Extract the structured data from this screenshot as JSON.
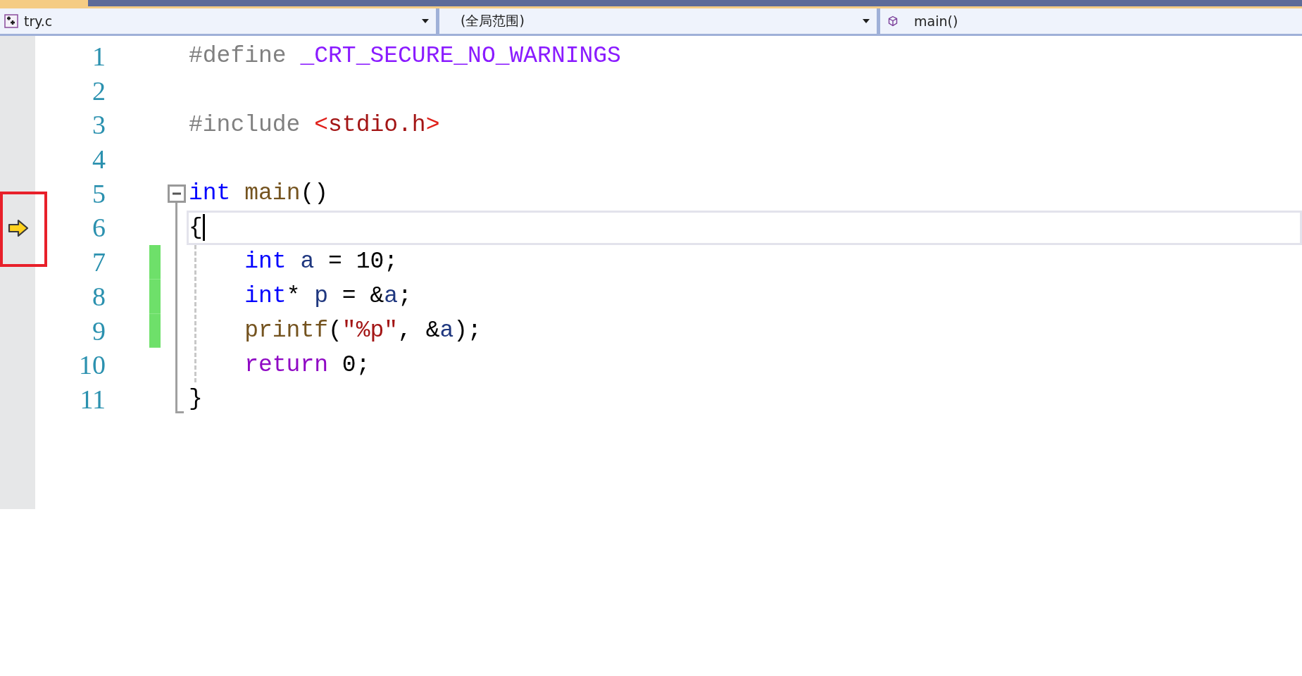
{
  "document_tab": {
    "selected": true
  },
  "navigation_bar": {
    "file": {
      "label": "try.c"
    },
    "scope": {
      "label": "(全局范围)"
    },
    "member": {
      "label": "main()"
    }
  },
  "editor": {
    "lines": [
      {
        "number": "1",
        "tokens": [
          {
            "kind": "preproc",
            "text": "#define "
          },
          {
            "kind": "macro",
            "text": "_CRT_SECURE_NO_WARNINGS"
          }
        ]
      },
      {
        "number": "2"
      },
      {
        "number": "3",
        "tokens": [
          {
            "kind": "preproc",
            "text": "#include "
          },
          {
            "kind": "bracket",
            "text": "<"
          },
          {
            "kind": "string",
            "text": "stdio.h"
          },
          {
            "kind": "bracket",
            "text": ">"
          }
        ]
      },
      {
        "number": "4"
      },
      {
        "number": "5",
        "fold_start": true,
        "expanded": true,
        "tokens": [
          {
            "kind": "keyword",
            "text": "int"
          },
          {
            "kind": "function",
            "text": " main"
          },
          {
            "kind": "plain",
            "text": "()"
          }
        ]
      },
      {
        "number": "6",
        "in_fold": true,
        "current": true,
        "execution_pointer": true,
        "annotated": true,
        "caret": true,
        "tokens": [
          {
            "kind": "plain",
            "text": "{"
          }
        ]
      },
      {
        "number": "7",
        "in_fold": true,
        "changed": true,
        "guide": true,
        "tokens": [
          {
            "kind": "keyword",
            "text": "    int"
          },
          {
            "kind": "variable",
            "text": " a"
          },
          {
            "kind": "plain",
            "text": " = 10;"
          }
        ]
      },
      {
        "number": "8",
        "in_fold": true,
        "changed": true,
        "guide": true,
        "tokens": [
          {
            "kind": "keyword",
            "text": "    int"
          },
          {
            "kind": "plain",
            "text": "* "
          },
          {
            "kind": "variable",
            "text": "p"
          },
          {
            "kind": "plain",
            "text": " = &"
          },
          {
            "kind": "variable",
            "text": "a"
          },
          {
            "kind": "plain",
            "text": ";"
          }
        ]
      },
      {
        "number": "9",
        "in_fold": true,
        "changed": true,
        "guide": true,
        "tokens": [
          {
            "kind": "function",
            "text": "    printf"
          },
          {
            "kind": "plain",
            "text": "("
          },
          {
            "kind": "string",
            "text": "\"%p\""
          },
          {
            "kind": "plain",
            "text": ", &"
          },
          {
            "kind": "variable",
            "text": "a"
          },
          {
            "kind": "plain",
            "text": ");"
          }
        ]
      },
      {
        "number": "10",
        "in_fold": true,
        "guide": true,
        "tokens": [
          {
            "kind": "control",
            "text": "    return"
          },
          {
            "kind": "plain",
            "text": " 0;"
          }
        ]
      },
      {
        "number": "11",
        "fold_end": true,
        "tokens": [
          {
            "kind": "plain",
            "text": "}"
          }
        ]
      }
    ]
  }
}
